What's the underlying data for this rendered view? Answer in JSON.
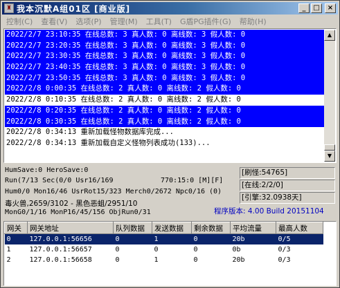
{
  "window": {
    "title": "我本沉默A组01区 [商业版]",
    "icon_glyph": "♜",
    "buttons": {
      "minimize": "_",
      "maximize": "□",
      "close": "×"
    }
  },
  "menu": [
    "控制(C)",
    "查看(V)",
    "选项(P)",
    "管理(M)",
    "工具(T)",
    "G盾PG插件(G)",
    "帮助(H)"
  ],
  "log": [
    {
      "text": "2022/2/7 23:10:35 在线总数: 3 真人数: 0 离线数: 3 假人数: 0",
      "selected": true
    },
    {
      "text": "2022/2/7 23:20:35 在线总数: 3 真人数: 0 离线数: 3 假人数: 0",
      "selected": true
    },
    {
      "text": "2022/2/7 23:30:35 在线总数: 3 真人数: 0 离线数: 3 假人数: 0",
      "selected": true
    },
    {
      "text": "2022/2/7 23:40:35 在线总数: 3 真人数: 0 离线数: 3 假人数: 0",
      "selected": true
    },
    {
      "text": "2022/2/7 23:50:35 在线总数: 3 真人数: 0 离线数: 3 假人数: 0",
      "selected": true
    },
    {
      "text": "2022/2/8 0:00:35 在线总数: 2 真人数: 0 离线数: 2 假人数: 0",
      "selected": true
    },
    {
      "text": "2022/2/8 0:10:35 在线总数: 2 真人数: 0 离线数: 2 假人数: 0",
      "selected": false
    },
    {
      "text": "2022/2/8 0:20:35 在线总数: 2 真人数: 0 离线数: 2 假人数: 0",
      "selected": true
    },
    {
      "text": "2022/2/8 0:30:35 在线总数: 2 真人数: 0 离线数: 2 假人数: 0",
      "selected": true
    },
    {
      "text": "2022/2/8 0:34:13 重新加载怪物数据库完成...",
      "selected": false
    },
    {
      "text": "2022/2/8 0:34:13 重新加载自定义怪物列表成功(133)...",
      "selected": false
    }
  ],
  "scroll": {
    "up_glyph": "▲",
    "down_glyph": "▼"
  },
  "status": {
    "line1": "HumSave:0 HeroSave:0",
    "line2": "Run(7/13 Sec(0/0 Usr16/169",
    "line2b": "770:15:0 [M][F]",
    "line3": "Hum0/0 Mon16/46 UsrRot15/323 Merch0/2672 Npc0/16 (0)",
    "line4": "毒火兽,2659/3102 - 黑色恶蛆/2951/10",
    "line5": "MonG0/1/16 MonP16/45/156 ObjRun0/31",
    "refresh": "[刷怪:54765]",
    "online": "[在线:2/2/0]",
    "engine": "[引擎:32.0938天]",
    "version": "程序版本: 4.00 Build 20151104"
  },
  "table": {
    "headers": [
      "网关",
      "网关地址",
      "队列数据",
      "发送数据",
      "剩余数据",
      "平均流量",
      "最高人数"
    ],
    "rows": [
      [
        "0",
        "127.0.0.1:56656",
        "0",
        "1",
        "0",
        "20b",
        "0/5"
      ],
      [
        "1",
        "127.0.0.1:56657",
        "0",
        "0",
        "0",
        "0b",
        "0/3"
      ],
      [
        "2",
        "127.0.0.1:56658",
        "0",
        "1",
        "0",
        "20b",
        "0/3"
      ]
    ],
    "selected_row": 0
  },
  "colors": {
    "selection": "#0000ff",
    "row_selection": "#0a246a",
    "version": "#0000c0"
  }
}
